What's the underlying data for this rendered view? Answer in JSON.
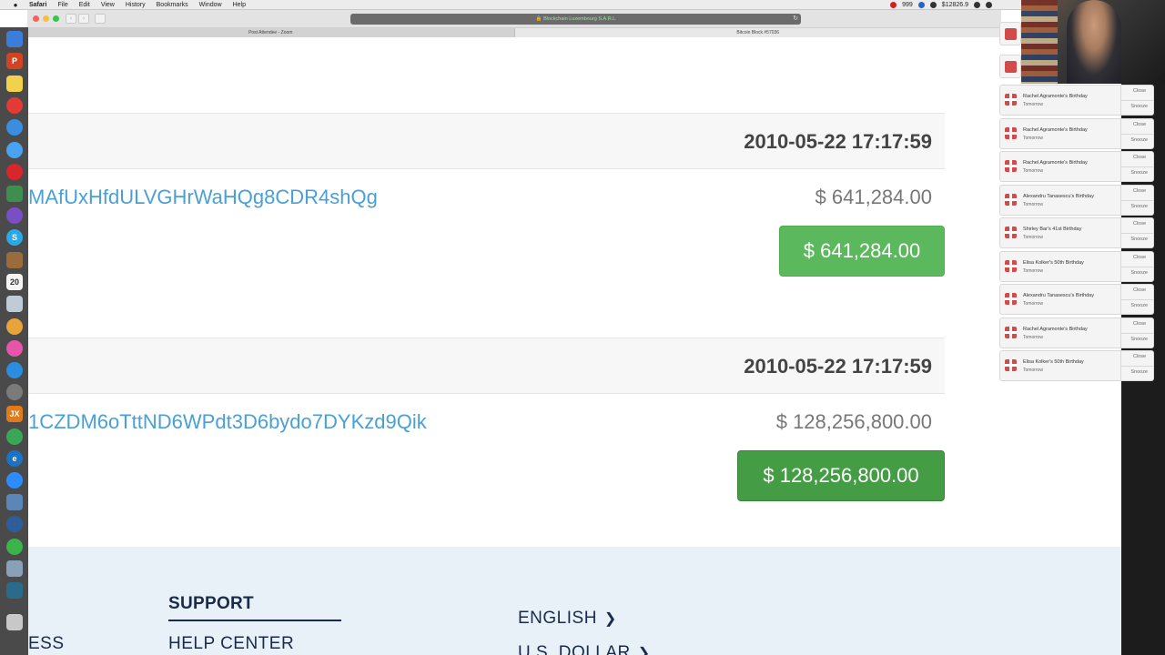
{
  "menubar": {
    "apple": "",
    "items": [
      "Safari",
      "File",
      "Edit",
      "View",
      "History",
      "Bookmarks",
      "Window",
      "Help"
    ],
    "status": [
      "999",
      "$12826.9"
    ]
  },
  "browser": {
    "url": "Blockchain Luxembourg S.A.R.L",
    "tabs": [
      "Post Attendee - Zoom",
      "Bitcoin Block #57036"
    ]
  },
  "transactions": [
    {
      "time": "2010-05-22 17:17:59",
      "address": "MAfUxHfdULVGHrWaHQg8CDR4shQg",
      "amount": "$ 641,284.00",
      "total": "$ 641,284.00"
    },
    {
      "time": "2010-05-22 17:17:59",
      "address": "1CZDM6oTttND6WPdt3D6bydo7DYKzd9Qik",
      "amount": "$ 128,256,800.00",
      "total": "$ 128,256,800.00"
    }
  ],
  "footer": {
    "left_partial": "ESS",
    "support_heading": "SUPPORT",
    "help_center": "HELP CENTER",
    "language": "ENGLISH",
    "currency": "U.S. DOLLAR"
  },
  "notifications": [
    {
      "title": "Rachel Agramonte's Birthday",
      "sub": "Tomorrow",
      "close": "Close",
      "snooze": "Snooze"
    },
    {
      "title": "Rachel Agramonte's Birthday",
      "sub": "Tomorrow",
      "close": "Close",
      "snooze": "Snooze"
    },
    {
      "title": "Rachel Agramonte's Birthday",
      "sub": "Tomorrow",
      "close": "Close",
      "snooze": "Snooze"
    },
    {
      "title": "Alexandru Tanasescu's Birthday",
      "sub": "Tomorrow",
      "close": "Close",
      "snooze": "Snooze"
    },
    {
      "title": "Shirley Bar's 41st Birthday",
      "sub": "Tomorrow",
      "close": "Close",
      "snooze": "Snooze"
    },
    {
      "title": "Elisa Kolker's 50th Birthday",
      "sub": "Tomorrow",
      "close": "Close",
      "snooze": "Snooze"
    },
    {
      "title": "Alexandru Tanasescu's Birthday",
      "sub": "Tomorrow",
      "close": "Close",
      "snooze": "Snooze"
    },
    {
      "title": "Rachel Agramonte's Birthday",
      "sub": "Tomorrow",
      "close": "Close",
      "snooze": "Snooze"
    },
    {
      "title": "Elisa Kolker's 50th Birthday",
      "sub": "Tomorrow",
      "close": "Close",
      "snooze": "Snooze"
    }
  ],
  "dock": {
    "icons": [
      "finder-icon",
      "powerpoint-icon",
      "notes-icon",
      "vivaldi-icon",
      "safari-icon",
      "messages-icon",
      "opera-icon",
      "kinemaster-icon",
      "viber-icon",
      "skype-icon",
      "notebook-icon",
      "calendar-icon",
      "preview-icon",
      "photos-icon",
      "itunes-icon",
      "appstore-icon",
      "system-preferences-icon",
      "jx-icon",
      "chrome-icon",
      "edge-icon",
      "zoom-icon",
      "preview2-icon",
      "globe-icon",
      "whatsapp-icon",
      "image-capture-icon",
      "x-icon",
      "trash-icon"
    ],
    "calendar_day": "20",
    "jx_label": "JX",
    "edge_label": "e",
    "skype_label": "S",
    "powerpoint_label": "P"
  }
}
